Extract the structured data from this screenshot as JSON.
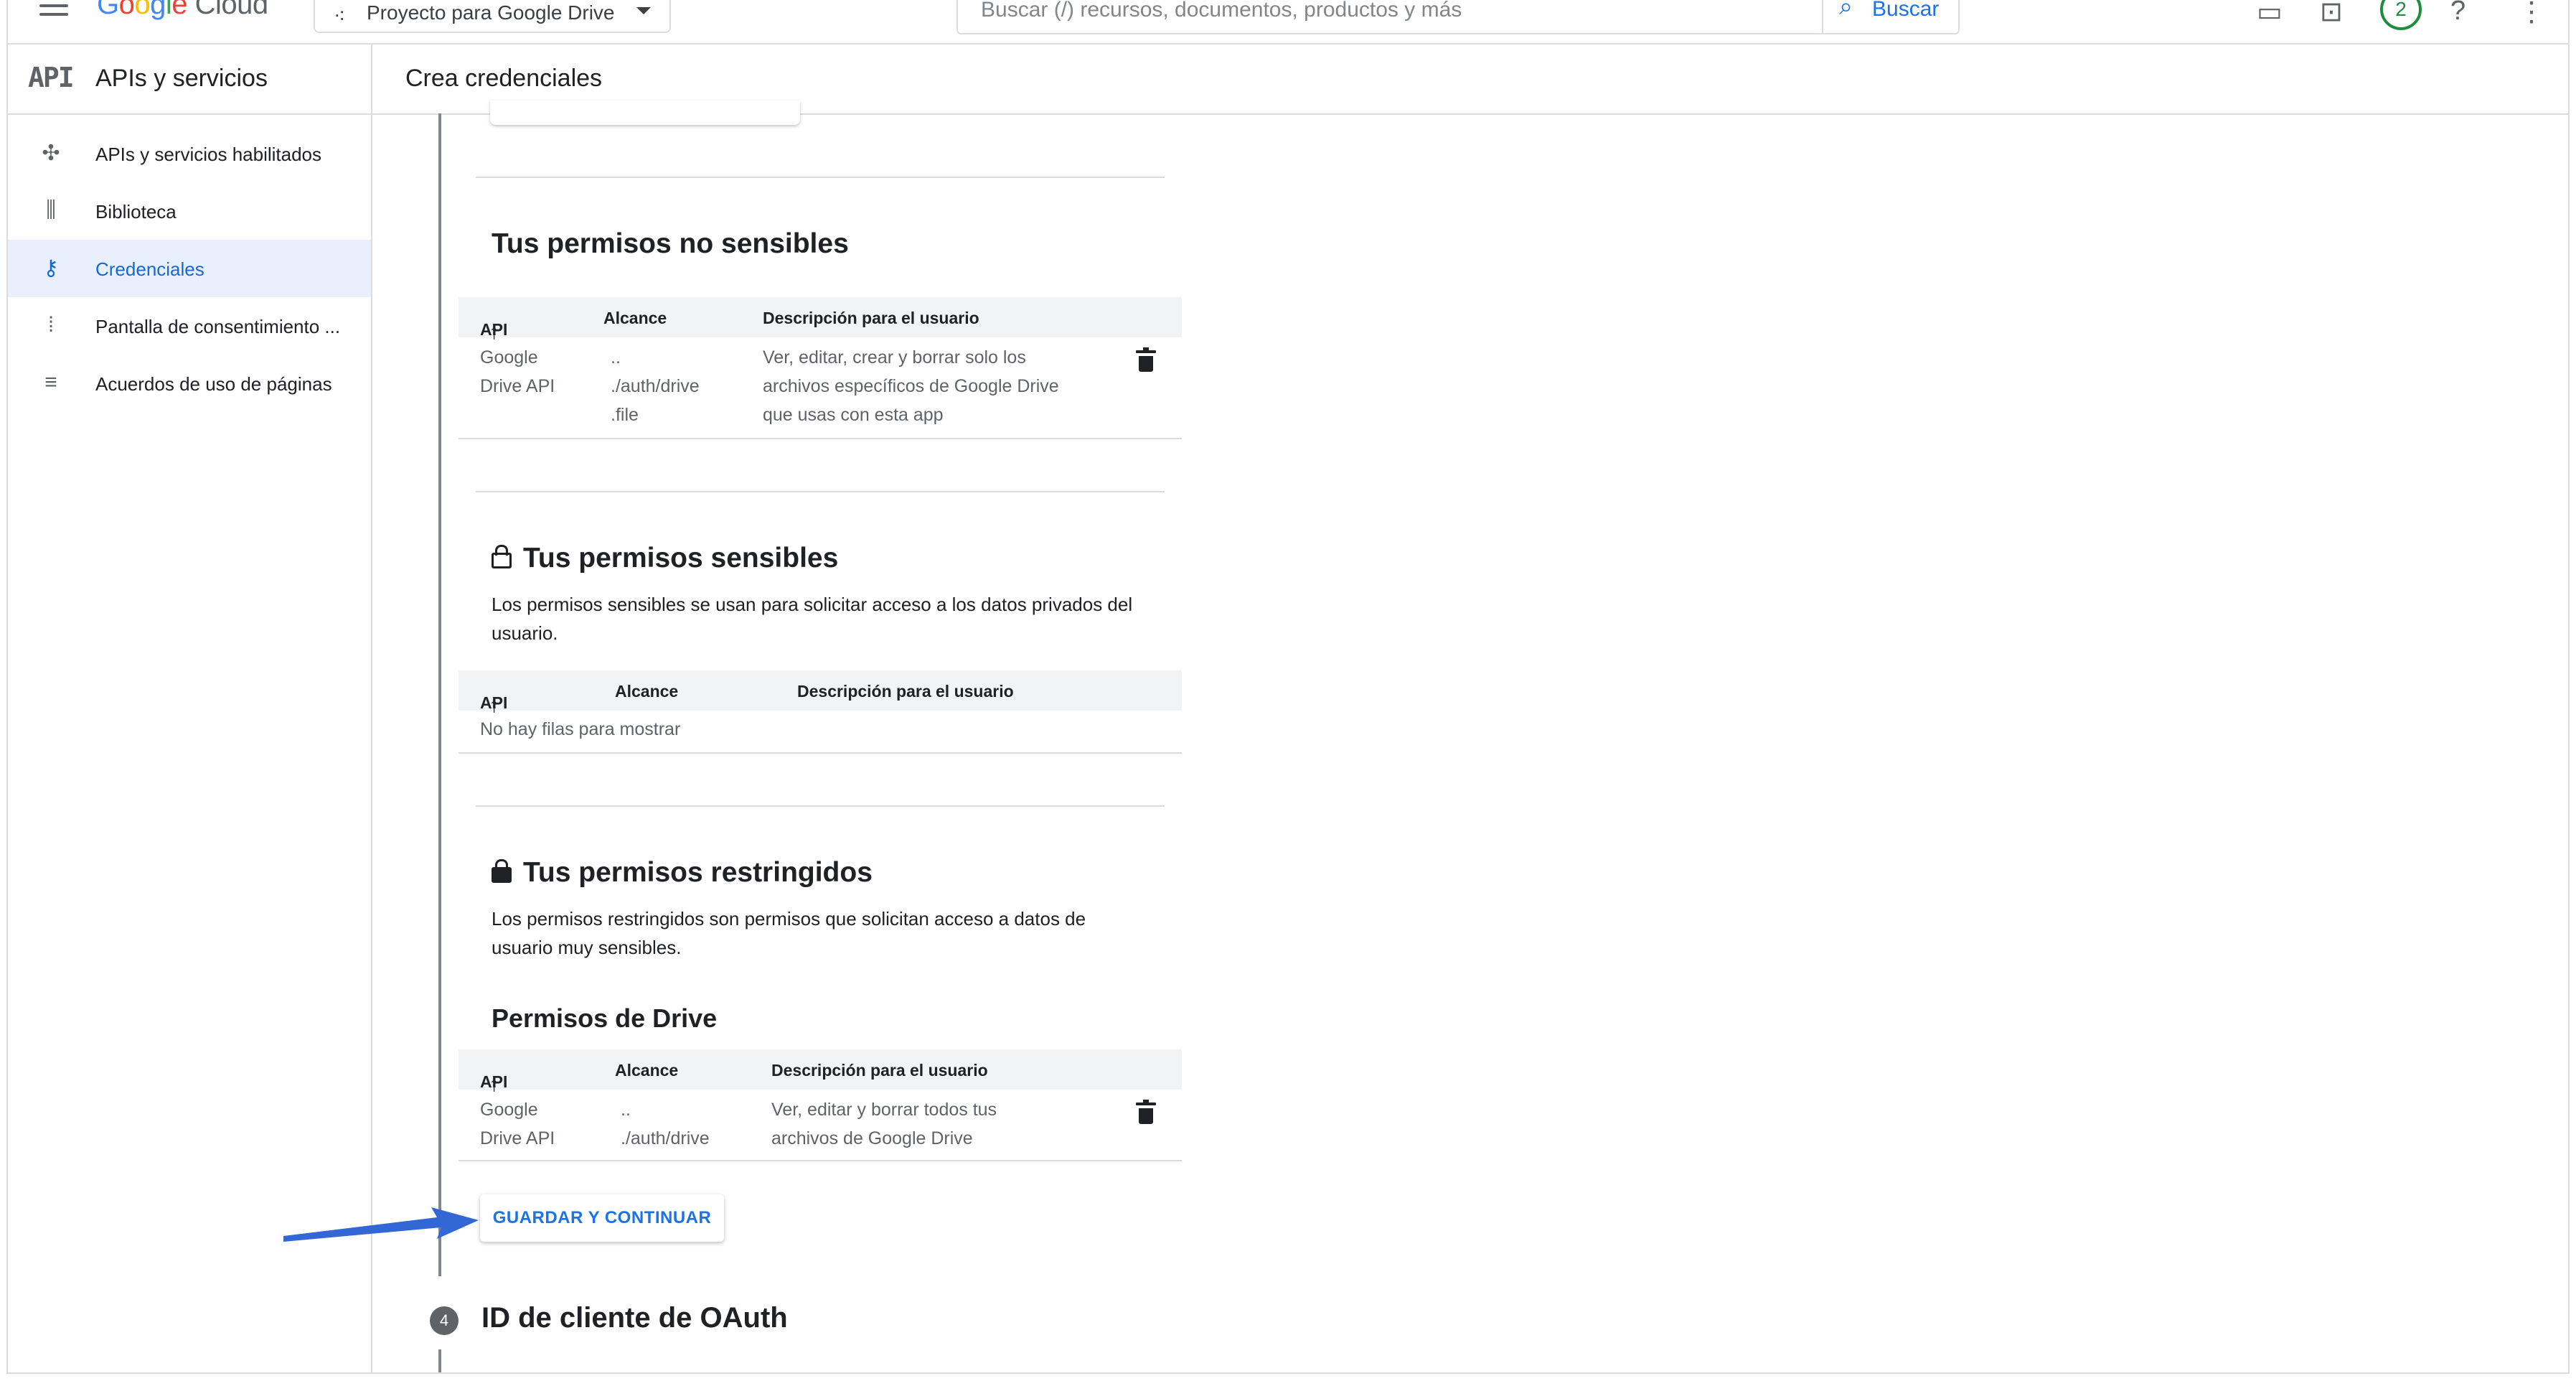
{
  "topbar": {
    "logo_parts": [
      "G",
      "o",
      "o",
      "g",
      "l",
      "e"
    ],
    "logo_suffix": " Cloud",
    "project_name": "Proyecto para Google Drive",
    "search_placeholder": "Buscar (/) recursos, documentos, productos y más",
    "search_button": "Buscar",
    "notification_count": "2"
  },
  "sidenav": {
    "logo": "API",
    "title": "APIs y servicios",
    "items": [
      {
        "label": "APIs y servicios habilitados",
        "icon": "apis-enabled-icon",
        "glyph": "✣"
      },
      {
        "label": "Biblioteca",
        "icon": "library-icon",
        "glyph": "⫼"
      },
      {
        "label": "Credenciales",
        "icon": "key-icon",
        "glyph": "⚷",
        "active": true
      },
      {
        "label": "Pantalla de consentimiento ...",
        "icon": "consent-screen-icon",
        "glyph": "⁞"
      },
      {
        "label": "Acuerdos de uso de páginas",
        "icon": "page-agreements-icon",
        "glyph": "≡"
      }
    ]
  },
  "main": {
    "title": "Crea credenciales",
    "non_sensitive": {
      "title": "Tus permisos no sensibles",
      "headers": {
        "api": "API",
        "scope": "Alcance",
        "description": "Descripción para el usuario"
      },
      "rows": [
        {
          "api": [
            "Google",
            "Drive API"
          ],
          "scope": [
            "..",
            "./auth/drive",
            ".file"
          ],
          "description": [
            "Ver, editar, crear y borrar solo los",
            "archivos específicos de Google Drive",
            "que usas con esta app"
          ]
        }
      ]
    },
    "sensitive": {
      "title": "Tus permisos sensibles",
      "description": "Los permisos sensibles se usan para solicitar acceso a los datos privados del usuario.",
      "headers": {
        "api": "API",
        "scope": "Alcance",
        "description": "Descripción para el usuario"
      },
      "empty": "No hay filas para mostrar"
    },
    "restricted": {
      "title": "Tus permisos restringidos",
      "description": "Los permisos restringidos son permisos que solicitan acceso a datos de usuario muy sensibles.",
      "subtitle": "Permisos de Drive",
      "headers": {
        "api": "API",
        "scope": "Alcance",
        "description": "Descripción para el usuario"
      },
      "rows": [
        {
          "api": [
            "Google",
            "Drive API"
          ],
          "scope": [
            "..",
            "./auth/drive"
          ],
          "description": [
            "Ver, editar y borrar todos tus",
            "archivos de Google Drive"
          ]
        }
      ]
    },
    "save_button": "GUARDAR Y CONTINUAR",
    "next_step": {
      "number": "4",
      "title": "ID de cliente de OAuth"
    }
  },
  "colors": {
    "accent": "#1a73e8",
    "active_bg": "#e8f0fe",
    "annotation_arrow": "#3367d6"
  }
}
